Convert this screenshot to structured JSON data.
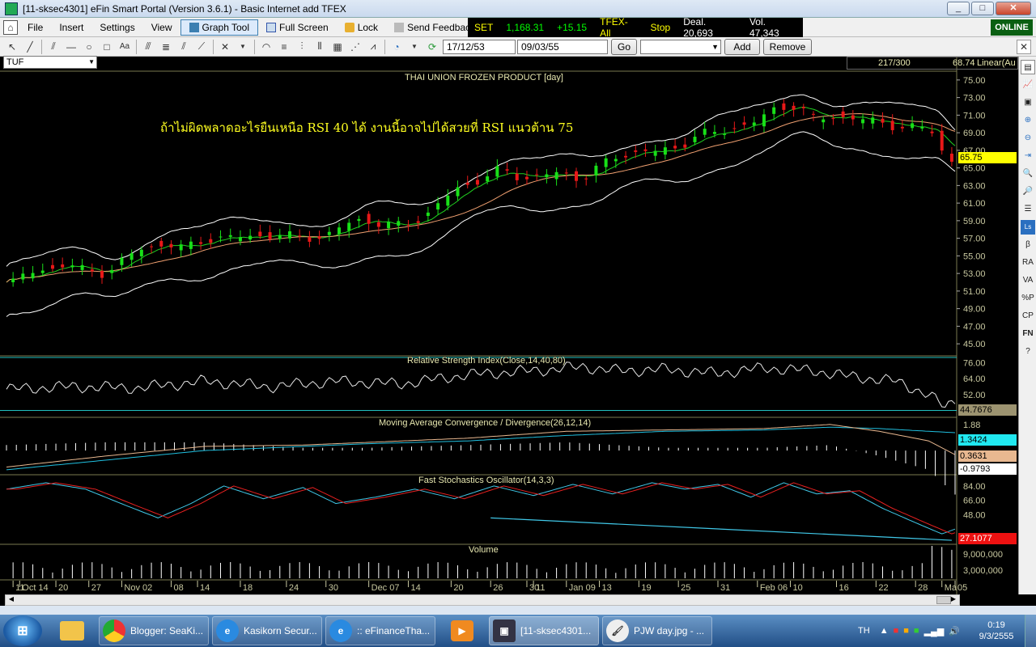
{
  "window": {
    "title": "[11-sksec4301] eFin Smart Portal (Version 3.6.1) - Basic Internet add TFEX",
    "min": "_",
    "max": "□",
    "close": "✕"
  },
  "menu": {
    "file": "File",
    "insert": "Insert",
    "settings": "Settings",
    "view": "View",
    "graph_tool": "Graph Tool",
    "full_screen": "Full Screen",
    "lock": "Lock",
    "send_feedback": "Send Feedback"
  },
  "ticker": {
    "index": "SET",
    "value": "1,168.31",
    "change": "+15.15",
    "tfex": "TFEX-All",
    "stop": "Stop",
    "deal": "Deal. 20,693",
    "vol": "Vol. 47,343"
  },
  "online": "ONLINE",
  "toolbar": {
    "date_from": "17/12/53",
    "date_to": "09/03/55",
    "go": "Go",
    "add": "Add",
    "remove": "Remove",
    "font_label": "Aa"
  },
  "symbol": "TUF",
  "top_info": {
    "count": "217/300",
    "scale": "68.74",
    "mode": "Linear(Au"
  },
  "chart_data": [
    {
      "type": "candlestick",
      "title": "THAI UNION FROZEN PRODUCT [day]",
      "annotation": "ถ้าไม่ผิดพลาดอะไรยืนเหนือ RSI 40 ได้ งานนี้อาจไปได้สวยที่ RSI แนวต้าน 75",
      "last_value": "65.75",
      "ylim": [
        44,
        76
      ],
      "y_ticks": [
        "75.00",
        "73.00",
        "71.00",
        "69.00",
        "67.00",
        "65.00",
        "63.00",
        "61.00",
        "59.00",
        "57.00",
        "55.00",
        "53.00",
        "51.00",
        "49.00",
        "47.00",
        "45.00"
      ],
      "x_ticks": [
        "11",
        "Oct 14",
        "20",
        "27",
        "Nov 02",
        "08",
        "14",
        "18",
        "24",
        "30",
        "Dec 07",
        "14",
        "20",
        "26",
        "30",
        "11",
        "Jan 09",
        "13",
        "19",
        "25",
        "31",
        "Feb 06",
        "10",
        "16",
        "22",
        "28",
        "Ma",
        "05"
      ],
      "close_anchors": [
        [
          0,
          52.0
        ],
        [
          6,
          52.8
        ],
        [
          12,
          53.4
        ],
        [
          18,
          54.2
        ],
        [
          24,
          53.2
        ],
        [
          30,
          53.0
        ],
        [
          36,
          54.8
        ],
        [
          42,
          55.8
        ],
        [
          48,
          56.5
        ],
        [
          54,
          55.8
        ],
        [
          60,
          56.8
        ],
        [
          66,
          57.2
        ],
        [
          72,
          57.0
        ],
        [
          78,
          57.4
        ],
        [
          84,
          57.3
        ],
        [
          90,
          57.0
        ],
        [
          96,
          57.2
        ],
        [
          102,
          58.3
        ],
        [
          108,
          59.2
        ],
        [
          114,
          58.6
        ],
        [
          120,
          58.4
        ],
        [
          126,
          59.3
        ],
        [
          132,
          61.2
        ],
        [
          138,
          62.8
        ],
        [
          144,
          63.8
        ],
        [
          150,
          64.8
        ],
        [
          156,
          63.8
        ],
        [
          162,
          64.2
        ],
        [
          168,
          64.3
        ],
        [
          174,
          63.8
        ],
        [
          180,
          65.2
        ],
        [
          186,
          66.3
        ],
        [
          192,
          67.0
        ],
        [
          198,
          66.8
        ],
        [
          204,
          67.3
        ],
        [
          210,
          69.0
        ],
        [
          216,
          68.8
        ],
        [
          222,
          69.8
        ],
        [
          228,
          70.3
        ],
        [
          234,
          71.8
        ],
        [
          240,
          72.2
        ],
        [
          246,
          70.3
        ],
        [
          252,
          71.0
        ],
        [
          258,
          70.6
        ],
        [
          264,
          70.2
        ],
        [
          270,
          69.8
        ],
        [
          276,
          69.6
        ],
        [
          282,
          69.0
        ],
        [
          286,
          65.2
        ],
        [
          288,
          66.5
        ]
      ]
    },
    {
      "type": "line",
      "title": "Relative Strength Index(Close,14,40,80)",
      "y_ticks": [
        "76.00",
        "64.00",
        "52.00"
      ],
      "last_value": "44.7676",
      "ylim": [
        36,
        80
      ],
      "anchors": [
        [
          0,
          56
        ],
        [
          20,
          58
        ],
        [
          40,
          57
        ],
        [
          60,
          62
        ],
        [
          80,
          58
        ],
        [
          100,
          62
        ],
        [
          120,
          60
        ],
        [
          140,
          67
        ],
        [
          160,
          70
        ],
        [
          175,
          73
        ],
        [
          185,
          70
        ],
        [
          200,
          71
        ],
        [
          215,
          68
        ],
        [
          230,
          72
        ],
        [
          245,
          70
        ],
        [
          255,
          66
        ],
        [
          270,
          62
        ],
        [
          280,
          52
        ],
        [
          285,
          42
        ],
        [
          288,
          48
        ]
      ]
    },
    {
      "type": "line",
      "title": "Moving Average Convergence / Divergence(26,12,14)",
      "y_ticks": [
        "1.88",
        "0.3631"
      ],
      "values": {
        "macd": "1.3424",
        "signal": "0.3631",
        "hist": "-0.9793"
      },
      "ylim": [
        -1.7,
        2.3
      ],
      "macd_anchors": [
        [
          0,
          -1.2
        ],
        [
          30,
          -0.4
        ],
        [
          60,
          0.3
        ],
        [
          90,
          0.4
        ],
        [
          110,
          0.6
        ],
        [
          140,
          0.9
        ],
        [
          170,
          1.4
        ],
        [
          200,
          1.5
        ],
        [
          230,
          1.6
        ],
        [
          250,
          1.9
        ],
        [
          265,
          1.4
        ],
        [
          280,
          0.7
        ],
        [
          288,
          -0.3
        ]
      ],
      "signal_anchors": [
        [
          0,
          -1.4
        ],
        [
          30,
          -0.7
        ],
        [
          60,
          0.0
        ],
        [
          90,
          0.3
        ],
        [
          110,
          0.5
        ],
        [
          140,
          0.7
        ],
        [
          170,
          1.1
        ],
        [
          200,
          1.4
        ],
        [
          230,
          1.5
        ],
        [
          250,
          1.7
        ],
        [
          265,
          1.6
        ],
        [
          280,
          1.4
        ],
        [
          288,
          1.3
        ]
      ]
    },
    {
      "type": "line",
      "title": "Fast Stochastics Oscillator(14,3,3)",
      "y_ticks": [
        "84.00",
        "66.00",
        "48.00"
      ],
      "last_value": "27.1077",
      "ylim": [
        12,
        96
      ],
      "anchors": [
        [
          0,
          80
        ],
        [
          12,
          88
        ],
        [
          24,
          80
        ],
        [
          36,
          60
        ],
        [
          46,
          44
        ],
        [
          56,
          62
        ],
        [
          66,
          84
        ],
        [
          78,
          68
        ],
        [
          90,
          82
        ],
        [
          100,
          62
        ],
        [
          112,
          70
        ],
        [
          124,
          80
        ],
        [
          136,
          68
        ],
        [
          148,
          84
        ],
        [
          160,
          72
        ],
        [
          172,
          86
        ],
        [
          184,
          74
        ],
        [
          196,
          88
        ],
        [
          206,
          80
        ],
        [
          216,
          86
        ],
        [
          226,
          70
        ],
        [
          236,
          88
        ],
        [
          246,
          74
        ],
        [
          256,
          78
        ],
        [
          266,
          56
        ],
        [
          276,
          38
        ],
        [
          284,
          24
        ],
        [
          288,
          30
        ]
      ]
    },
    {
      "type": "bar",
      "title": "Volume",
      "y_ticks": [
        "9,000,000",
        "3,000,000"
      ]
    }
  ],
  "taskbar": {
    "t1": "Blogger: SeaKi...",
    "t2": "Kasikorn Secur...",
    "t3": ":: eFinanceTha...",
    "t4": "[11-sksec4301...",
    "t5": "PJW day.jpg - ...",
    "lang": "TH",
    "time": "0:19",
    "date": "9/3/2555"
  },
  "sidebar_labels": [
    "β",
    "RA",
    "VA",
    "%P",
    "CP",
    "FN"
  ]
}
